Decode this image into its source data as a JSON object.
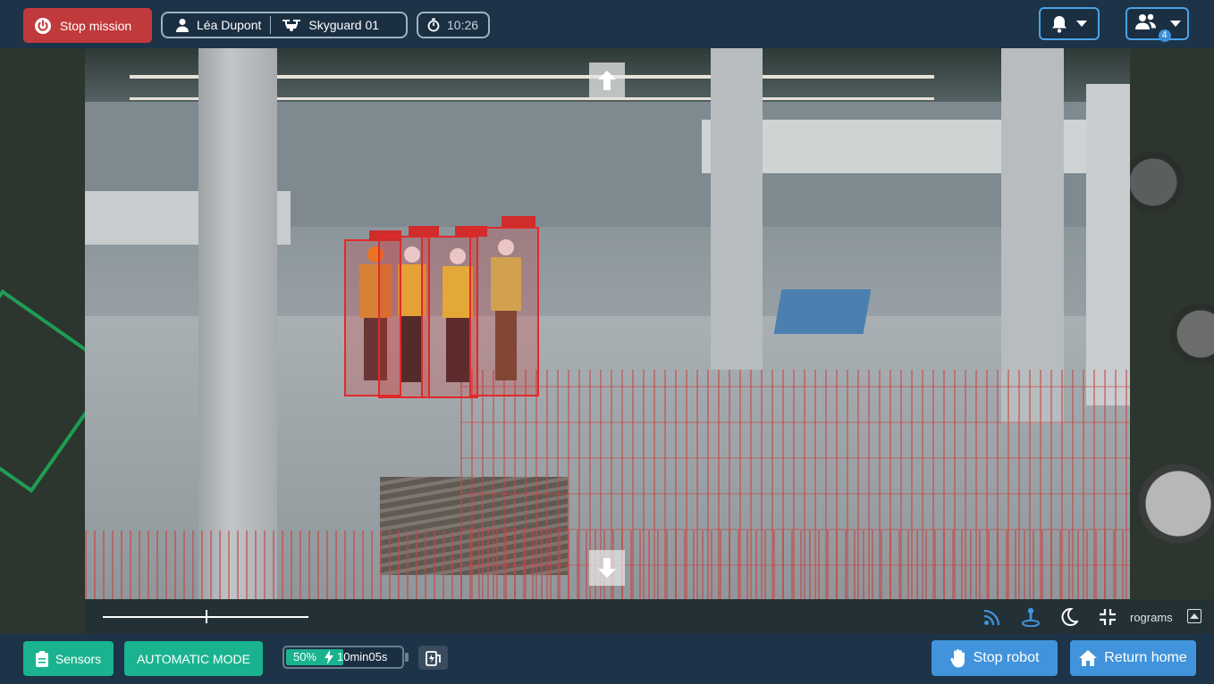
{
  "header": {
    "stop_mission_label": "Stop mission",
    "user_name": "Léa Dupont",
    "robot_name": "Skyguard 01",
    "timer": "10:26",
    "team_count": "4"
  },
  "video": {
    "scrub_position": 0.5,
    "programs_label": "rograms"
  },
  "footer": {
    "sensors_label": "Sensors",
    "mode_label": "AUTOMATIC MODE",
    "battery_percent_label": "50%",
    "battery_level": 0.5,
    "battery_time": "10min05s",
    "stop_robot_label": "Stop robot",
    "return_home_label": "Return home"
  },
  "colors": {
    "danger": "#c0393b",
    "accent_green": "#1ab38f",
    "accent_blue": "#4194db",
    "detection_red": "#e02a2a",
    "background": "#1d3347"
  },
  "icons": [
    "power-icon",
    "user-icon",
    "drone-icon",
    "stopwatch-icon",
    "bell-icon",
    "chevron-down-icon",
    "team-icon",
    "arrow-up-icon",
    "arrow-down-icon",
    "signal-icon",
    "joystick-icon",
    "moon-icon",
    "collapse-icon",
    "expand-panel-icon",
    "clipboard-icon",
    "bolt-icon",
    "dock-icon",
    "hand-icon",
    "home-icon"
  ]
}
